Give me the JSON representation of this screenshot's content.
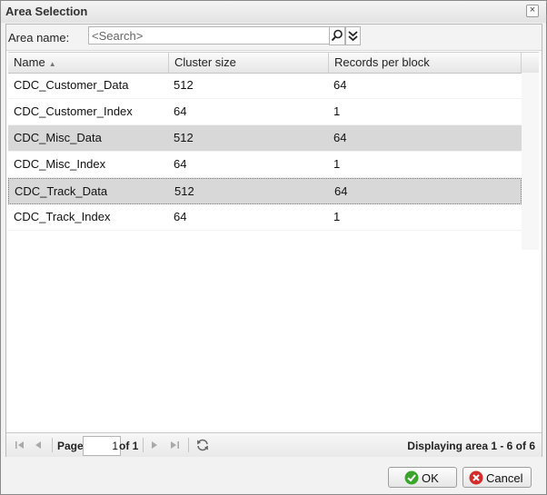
{
  "dialog": {
    "title": "Area Selection",
    "close_glyph": "×"
  },
  "search": {
    "label": "Area name:",
    "placeholder": "<Search>",
    "value": ""
  },
  "grid": {
    "columns": [
      "Name",
      "Cluster size",
      "Records per block"
    ],
    "sort": {
      "column": "Name",
      "direction": "ascending"
    },
    "rows": [
      {
        "name": "CDC_Customer_Data",
        "cluster_size": "512",
        "records_per_block": "64"
      },
      {
        "name": "CDC_Customer_Index",
        "cluster_size": "64",
        "records_per_block": "1"
      },
      {
        "name": "CDC_Misc_Data",
        "cluster_size": "512",
        "records_per_block": "64"
      },
      {
        "name": "CDC_Misc_Index",
        "cluster_size": "64",
        "records_per_block": "1"
      },
      {
        "name": "CDC_Track_Data",
        "cluster_size": "512",
        "records_per_block": "64"
      },
      {
        "name": "CDC_Track_Index",
        "cluster_size": "64",
        "records_per_block": "1"
      }
    ],
    "selected_row": "CDC_Track_Data"
  },
  "pager": {
    "page_label": "Page",
    "page_value": "1",
    "of_label": "of 1",
    "display_info": "Displaying area 1 - 6 of 6"
  },
  "buttons": {
    "ok_label": "OK",
    "cancel_label": "Cancel"
  },
  "colors": {
    "ok_icon": "#3aa52a",
    "cancel_icon": "#d42a2a",
    "row_highlight": "#d8d8d8"
  }
}
